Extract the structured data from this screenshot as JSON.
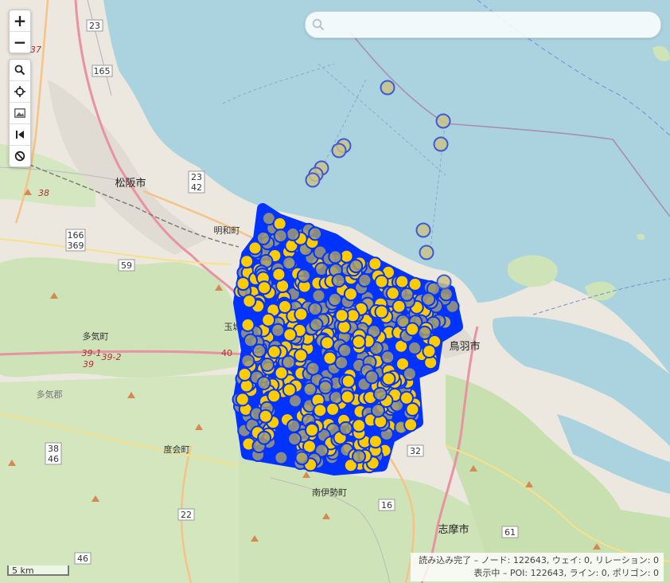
{
  "search": {
    "placeholder": "",
    "value": ""
  },
  "zoom": {
    "in_label": "+",
    "out_label": "−"
  },
  "tools": [
    {
      "name": "search-tool-button",
      "icon": "magnifier-icon"
    },
    {
      "name": "locate-button",
      "icon": "crosshair-icon"
    },
    {
      "name": "image-button",
      "icon": "image-icon"
    },
    {
      "name": "back-button",
      "icon": "skip-back-icon"
    },
    {
      "name": "clear-button",
      "icon": "prohibit-icon"
    }
  ],
  "places": {
    "matsusaka": "松阪市",
    "meiwa": "明和町",
    "taki": "多気町",
    "taki_gun": "多気郡",
    "tamaki": "玉城町",
    "watarai": "度会町",
    "minamiise": "南伊勢町",
    "toba": "鳥羽市",
    "shima": "志摩市"
  },
  "routes": {
    "r23_top": "23",
    "r165": "165",
    "r23_42a": "23",
    "r23_42b": "42",
    "r166a": "166",
    "r166b": "369",
    "r59": "59",
    "r40": "40",
    "r38_46a": "38",
    "r38_46b": "46",
    "r32": "32",
    "r16": "16",
    "r22": "22",
    "r46": "46",
    "r61": "61",
    "r37": "37",
    "r38": "38",
    "r39_1": "39-1",
    "r39_2": "39-2",
    "r39": "39"
  },
  "status": {
    "line1": "読み込み完了 – ノード: 122643, ウェイ: 0, リレーション: 0",
    "line2": "表示中 – POI: 122643, ライン: 0, ポリゴン: 0"
  },
  "scale": {
    "label": "5 km"
  },
  "colors": {
    "sea": "#aad3df",
    "land": "#f2efe9",
    "forest": "#cde2b8",
    "poi_fill": "#ffcc00",
    "poi_stroke": "#0033ff"
  }
}
